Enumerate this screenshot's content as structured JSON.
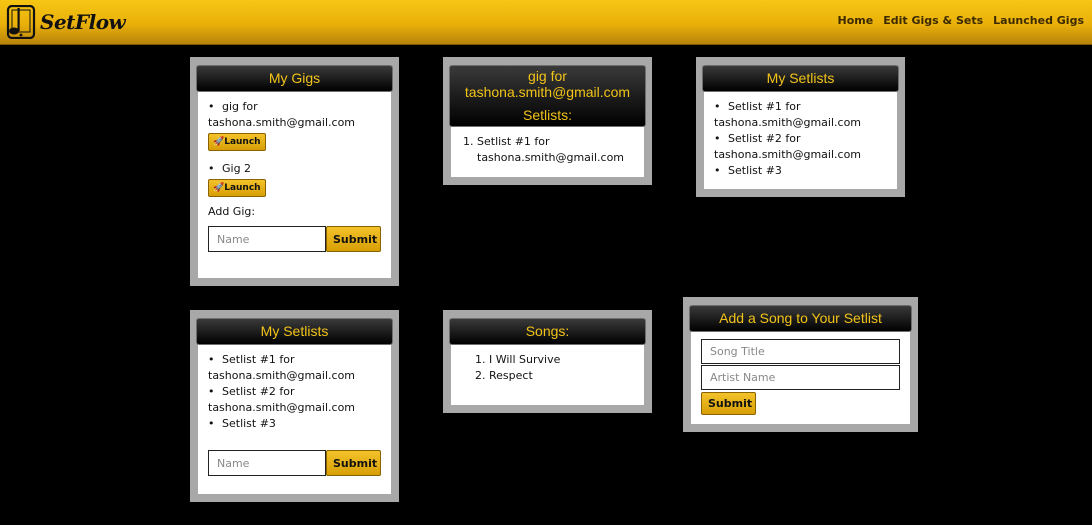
{
  "app": {
    "brand": "SetFlow"
  },
  "nav": {
    "links": [
      "Home",
      "Edit Gigs & Sets",
      "Launched Gigs"
    ]
  },
  "my_gigs": {
    "title": "My Gigs",
    "gigs": [
      {
        "name": "gig for tashona.smith@gmail.com",
        "launch_label": "🚀Launch"
      },
      {
        "name": "Gig 2",
        "launch_label": "🚀Launch"
      }
    ],
    "add_label": "Add Gig:",
    "name_placeholder": "Name",
    "submit_label": "Submit"
  },
  "gig_detail": {
    "title": "gig for tashona.smith@gmail.com",
    "subtitle": "Setlists:",
    "setlists": [
      "Setlist #1 for tashona.smith@gmail.com"
    ]
  },
  "my_setlists_top": {
    "title": "My Setlists",
    "items": [
      "Setlist #1 for tashona.smith@gmail.com",
      "Setlist #2 for tashona.smith@gmail.com",
      "Setlist #3"
    ]
  },
  "my_setlists_bottom": {
    "title": "My Setlists",
    "items": [
      "Setlist #1 for tashona.smith@gmail.com",
      "Setlist #2 for tashona.smith@gmail.com",
      "Setlist #3"
    ],
    "name_placeholder": "Name",
    "submit_label": "Submit"
  },
  "songs": {
    "title": "Songs:",
    "items": [
      "I Will Survive",
      "Respect"
    ]
  },
  "add_song": {
    "title": "Add a Song to Your Setlist",
    "title_placeholder": "Song Title",
    "artist_placeholder": "Artist Name",
    "submit_label": "Submit"
  },
  "colors": {
    "accent": "#f2c318",
    "navbar": "#eab00a",
    "card_border": "#a8a8a8"
  }
}
